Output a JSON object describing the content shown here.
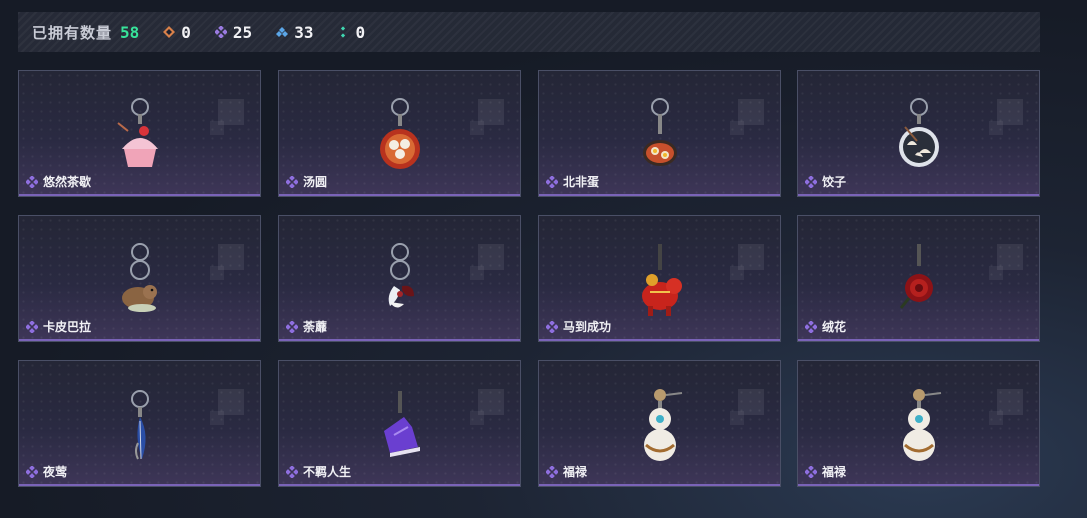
{
  "header": {
    "label": "已拥有数量",
    "total": "58",
    "stats": [
      {
        "icon": "orange-rarity-icon",
        "color": "#d9814a",
        "value": "0"
      },
      {
        "icon": "purple-rarity-icon",
        "color": "#9a7ae0",
        "value": "25"
      },
      {
        "icon": "blue-rarity-icon",
        "color": "#5ba6e8",
        "value": "33"
      },
      {
        "icon": "green-rarity-icon",
        "color": "#3fd7b0",
        "value": "0"
      }
    ]
  },
  "cards": [
    {
      "name": "悠然茶歇",
      "icon": "cupcake-charm-icon"
    },
    {
      "name": "汤圆",
      "icon": "tangyuan-bowl-charm-icon"
    },
    {
      "name": "北非蛋",
      "icon": "shakshuka-pan-charm-icon"
    },
    {
      "name": "饺子",
      "icon": "dumplings-plate-charm-icon"
    },
    {
      "name": "卡皮巴拉",
      "icon": "capybara-charm-icon"
    },
    {
      "name": "荼蘼",
      "icon": "flower-charm-icon"
    },
    {
      "name": "马到成功",
      "icon": "red-horse-charm-icon"
    },
    {
      "name": "绒花",
      "icon": "red-rose-charm-icon"
    },
    {
      "name": "夜莺",
      "icon": "feather-charm-icon"
    },
    {
      "name": "不羁人生",
      "icon": "purple-sneaker-charm-icon"
    },
    {
      "name": "福禄",
      "icon": "gourd-charm-icon"
    },
    {
      "name": "福禄",
      "icon": "gourd-charm-icon"
    }
  ],
  "rarity_color": "#8f6fe0"
}
